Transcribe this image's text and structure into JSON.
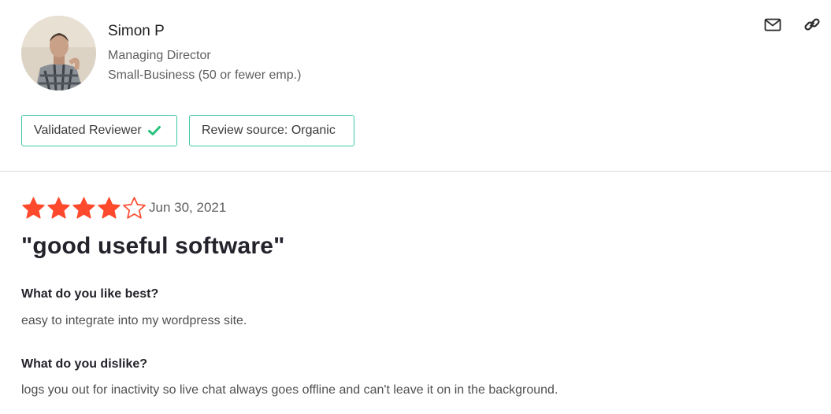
{
  "reviewer": {
    "name": "Simon P",
    "title": "Managing Director",
    "company_size": "Small-Business (50 or fewer emp.)"
  },
  "badges": {
    "validated": "Validated Reviewer",
    "source": "Review source: Organic"
  },
  "review": {
    "rating": 4,
    "max_rating": 5,
    "date": "Jun 30, 2021",
    "title": "\"good useful software\"",
    "questions": [
      {
        "label": "What do you like best?",
        "answer": "easy to integrate into my wordpress site."
      },
      {
        "label": "What do you dislike?",
        "answer": "logs you out for inactivity so live chat always goes offline and can't leave it on in the background."
      }
    ]
  },
  "icons": {
    "mail": "mail-icon",
    "link": "link-icon",
    "check": "check-icon",
    "star": "star-icon"
  },
  "colors": {
    "star": "#ff492c",
    "badge_border": "#3ec7a5",
    "check": "#27c27d",
    "divider": "#d9d9d9"
  }
}
